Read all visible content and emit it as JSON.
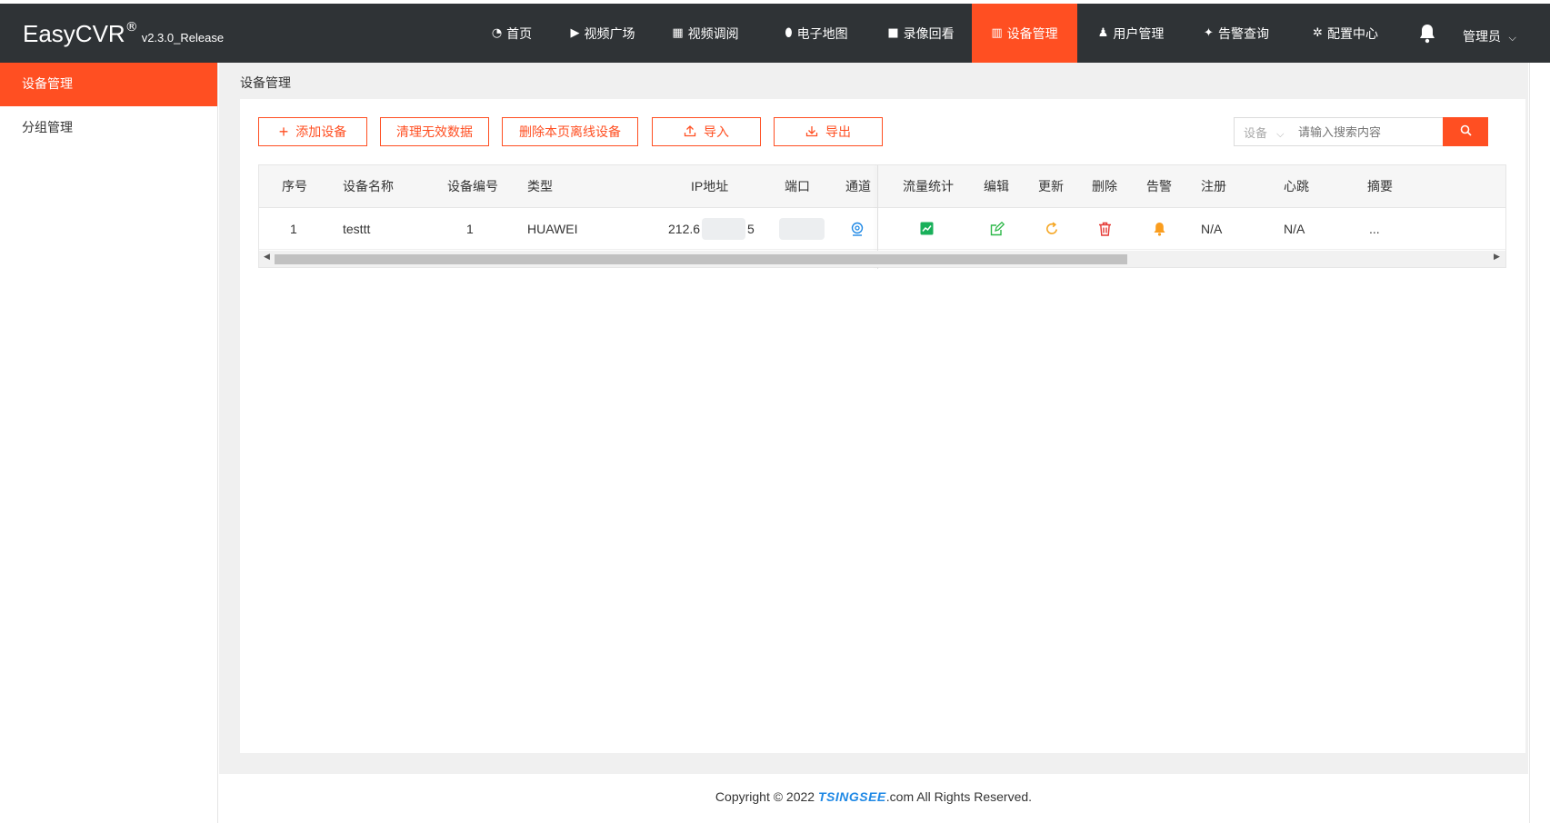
{
  "brand": {
    "name": "EasyCVR",
    "reg": "®",
    "version": "v2.3.0_Release"
  },
  "nav": {
    "items": [
      {
        "label": "首页",
        "icon": "dashboard-icon"
      },
      {
        "label": "视频广场",
        "icon": "play-circle-icon"
      },
      {
        "label": "视频调阅",
        "icon": "layout-icon"
      },
      {
        "label": "电子地图",
        "icon": "map-pin-icon"
      },
      {
        "label": "录像回看",
        "icon": "video-camera-icon"
      },
      {
        "label": "设备管理",
        "icon": "book-icon",
        "active": true
      },
      {
        "label": "用户管理",
        "icon": "user-icon"
      },
      {
        "label": "告警查询",
        "icon": "alarm-icon"
      },
      {
        "label": "配置中心",
        "icon": "gear-icon"
      }
    ],
    "user": "管理员"
  },
  "sidebar": {
    "items": [
      {
        "label": "设备管理",
        "active": true
      },
      {
        "label": "分组管理"
      }
    ]
  },
  "breadcrumb": "设备管理",
  "toolbar": {
    "add": "添加设备",
    "clean": "清理无效数据",
    "delete_offline": "删除本页离线设备",
    "import": "导入",
    "export": "导出"
  },
  "search": {
    "select": "设备",
    "placeholder": "请输入搜索内容"
  },
  "table": {
    "headers": [
      "序号",
      "设备名称",
      "设备编号",
      "类型",
      "IP地址",
      "端口",
      "通道",
      "流量统计",
      "编辑",
      "更新",
      "删除",
      "告警",
      "注册",
      "心跳",
      "摘要"
    ],
    "rows": [
      {
        "index": "1",
        "name": "testtt",
        "code": "1",
        "type": "HUAWEI",
        "ip": "212.6",
        "ip_tail": "5",
        "register": "N/A",
        "heartbeat": "N/A",
        "summary": "..."
      }
    ]
  },
  "colors": {
    "accent": "#ff4f22",
    "topbar": "#2f3336",
    "channel": "#1e88e5",
    "stats": "#19b05a",
    "edit": "#2fb84a",
    "refresh": "#f5a623",
    "delete": "#e53935",
    "alarm": "#fa9d1e"
  },
  "footer": {
    "prefix": "Copyright © 2022 ",
    "logo": "TSINGSEE",
    "suffix": ".com All Rights Reserved."
  }
}
